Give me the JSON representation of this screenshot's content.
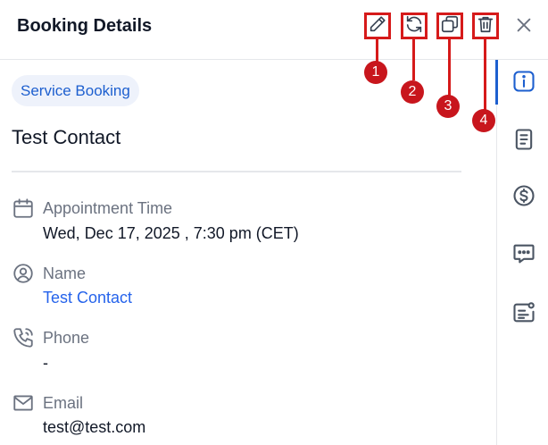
{
  "header": {
    "title": "Booking Details",
    "actions": [
      {
        "icon": "edit-icon",
        "marker": "1"
      },
      {
        "icon": "reschedule-icon",
        "marker": "2"
      },
      {
        "icon": "copy-icon",
        "marker": "3"
      },
      {
        "icon": "trash-icon",
        "marker": "4"
      }
    ],
    "close_icon": "close-icon"
  },
  "main": {
    "badge": "Service Booking",
    "contact_name": "Test Contact",
    "fields": [
      {
        "icon": "calendar-icon",
        "label": "Appointment Time",
        "value": "Wed, Dec 17, 2025 , 7:30 pm (CET)"
      },
      {
        "icon": "user-icon",
        "label": "Name",
        "value": "Test Contact"
      },
      {
        "icon": "phone-icon",
        "label": "Phone",
        "value": "-"
      },
      {
        "icon": "mail-icon",
        "label": "Email",
        "value": "test@test.com"
      }
    ]
  },
  "sidebar": {
    "items": [
      {
        "icon": "info-icon",
        "active": true
      },
      {
        "icon": "notes-icon",
        "active": false
      },
      {
        "icon": "dollar-icon",
        "active": false
      },
      {
        "icon": "chat-icon",
        "active": false
      },
      {
        "icon": "contact-card-icon",
        "active": false
      }
    ]
  },
  "colors": {
    "accent": "#1d5fcf",
    "link": "#2563eb",
    "annotation": "#d61a1a",
    "muted_text": "#6b7280"
  }
}
